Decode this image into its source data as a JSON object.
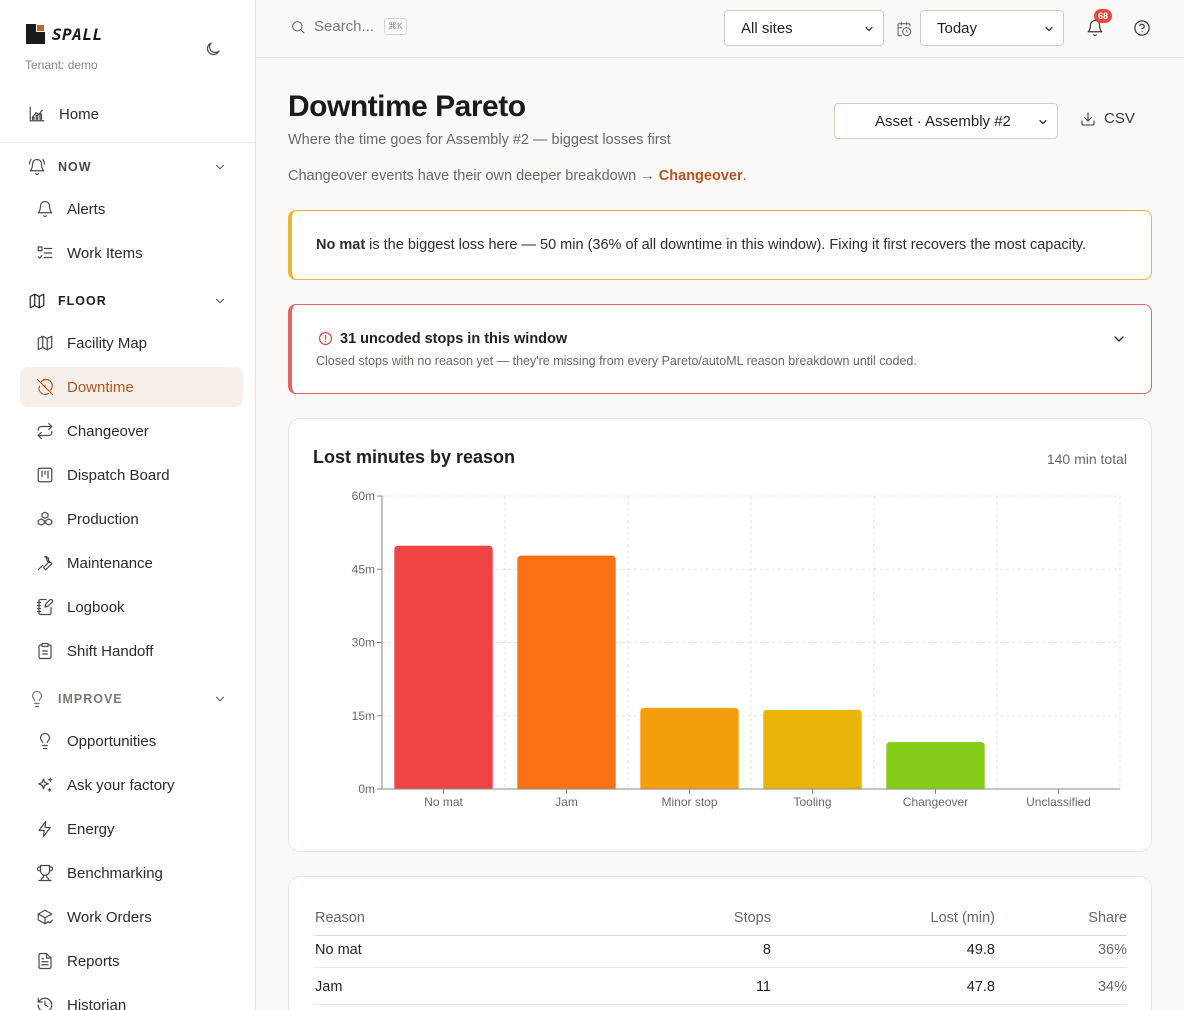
{
  "brand": {
    "name": "SPALL",
    "tenant": "Tenant: demo"
  },
  "sidebar": {
    "home": "Home",
    "sections": [
      {
        "label": "NOW",
        "items": [
          "Alerts",
          "Work Items"
        ]
      },
      {
        "label": "FLOOR",
        "items": [
          "Facility Map",
          "Downtime",
          "Changeover",
          "Dispatch Board",
          "Production",
          "Maintenance",
          "Logbook",
          "Shift Handoff"
        ]
      },
      {
        "label": "IMPROVE",
        "items": [
          "Opportunities",
          "Ask your factory",
          "Energy",
          "Benchmarking",
          "Work Orders",
          "Reports",
          "Historian"
        ]
      }
    ],
    "active": "Downtime"
  },
  "topbar": {
    "search_placeholder": "Search...",
    "search_shortcut": "⌘K",
    "site_select": "All sites",
    "range_select": "Today",
    "notification_count": "68"
  },
  "page": {
    "title": "Downtime Pareto",
    "subtitle": "Where the time goes for Assembly #2 — biggest losses first",
    "note_prefix": "Changeover events have their own deeper breakdown → ",
    "note_link": "Changeover",
    "note_suffix": ".",
    "asset_select": "Asset · Assembly #2",
    "csv_label": "CSV"
  },
  "insight": {
    "bold": "No mat",
    "text": "is the biggest loss here — 50 min (36% of all downtime in this window). Fixing it first recovers the most capacity.",
    "accent": "#eab53a"
  },
  "uncoded": {
    "title": "31 uncoded stops in this window",
    "subtitle": "Closed stops with no reason yet — they're missing from every Pareto/autoML reason breakdown until coded.",
    "accent": "#e06666"
  },
  "chart_card": {
    "title": "Lost minutes by reason",
    "total": "140 min total"
  },
  "chart_data": {
    "type": "bar",
    "categories": [
      "No mat",
      "Jam",
      "Minor stop",
      "Tooling",
      "Changeover",
      "Unclassified"
    ],
    "values": [
      49.8,
      47.8,
      16.6,
      16.2,
      9.6,
      0
    ],
    "colors": [
      "#ef4444",
      "#f97316",
      "#f59e0b",
      "#eab308",
      "#84cc16",
      "#22c55e"
    ],
    "ylim": [
      0,
      60
    ],
    "yticks": [
      0,
      15,
      30,
      45,
      60
    ],
    "ytick_labels": [
      "0m",
      "15m",
      "30m",
      "45m",
      "60m"
    ],
    "grid": true,
    "xlabel": "",
    "ylabel": ""
  },
  "table": {
    "headers": [
      "Reason",
      "Stops",
      "Lost (min)",
      "Share"
    ],
    "rows": [
      [
        "No mat",
        "8",
        "49.8",
        "36%"
      ],
      [
        "Jam",
        "11",
        "47.8",
        "34%"
      ]
    ]
  }
}
